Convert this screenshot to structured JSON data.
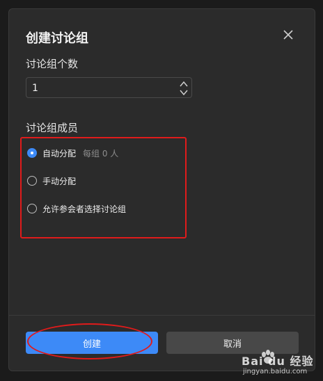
{
  "dialog": {
    "title": "创建讨论组",
    "count_label": "讨论组个数",
    "count_value": "1",
    "members_label": "讨论组成员",
    "options": [
      {
        "label": "自动分配",
        "hint": "每组 0 人",
        "checked": true
      },
      {
        "label": "手动分配",
        "checked": false
      },
      {
        "label": "允许参会者选择讨论组",
        "checked": false
      }
    ],
    "create_label": "创建",
    "cancel_label": "取消"
  },
  "watermark": {
    "brand": "Bai du 经验",
    "url": "jingyan.baidu.com"
  },
  "colors": {
    "accent": "#3d8af7",
    "annotation": "#e01b1b",
    "dialog_bg": "#2b2b2b"
  }
}
